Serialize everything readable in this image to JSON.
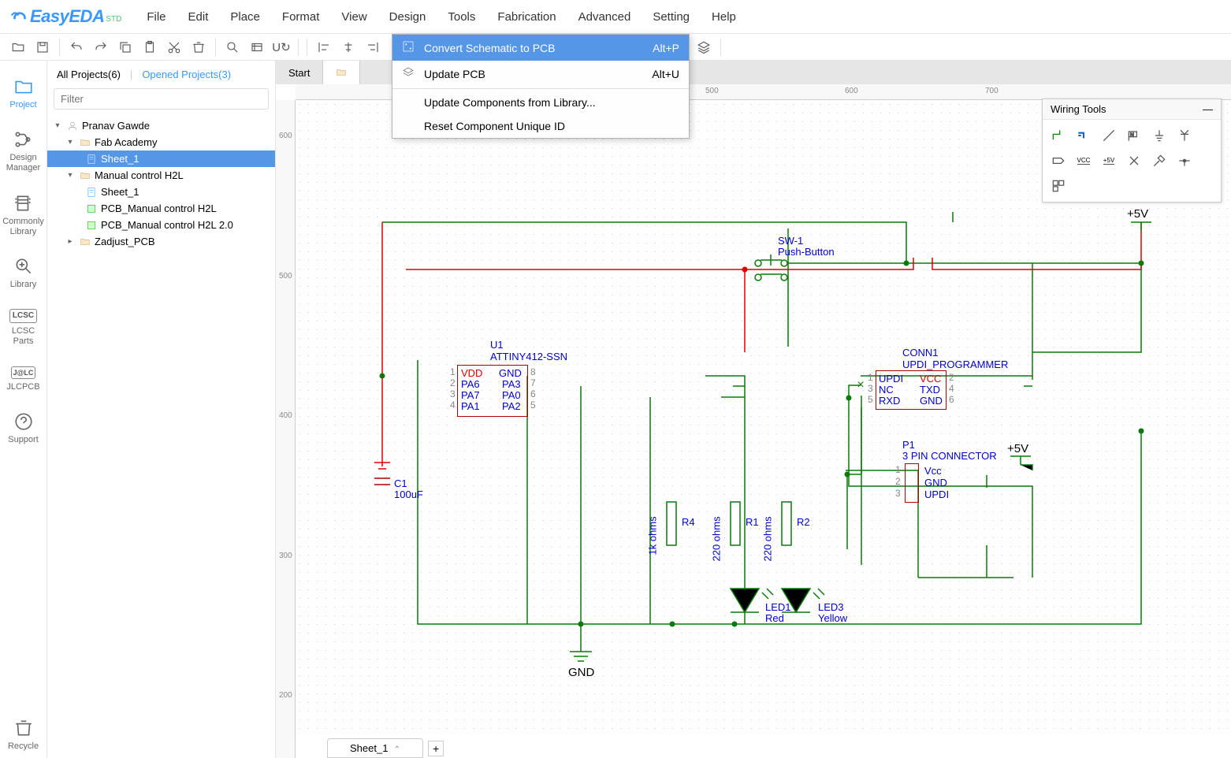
{
  "app": {
    "name": "EasyEDA",
    "edition": "STD"
  },
  "menubar": [
    "File",
    "Edit",
    "Place",
    "Format",
    "View",
    "Design",
    "Tools",
    "Fabrication",
    "Advanced",
    "Setting",
    "Help"
  ],
  "dropdown": {
    "items": [
      {
        "label": "Convert Schematic to PCB",
        "shortcut": "Alt+P",
        "highlighted": true
      },
      {
        "label": "Update PCB",
        "shortcut": "Alt+U"
      },
      {
        "sep": true
      },
      {
        "label": "Update Components from Library..."
      },
      {
        "label": "Reset Component Unique ID"
      }
    ]
  },
  "sidebar": [
    "Project",
    "Design\nManager",
    "Commonly\nLibrary",
    "Library",
    "LCSC\nParts",
    "JLCPCB",
    "Support",
    "Recycle"
  ],
  "proj_tabs": {
    "all": "All Projects(6)",
    "opened": "Opened Projects(3)"
  },
  "filter_placeholder": "Filter",
  "tree": {
    "owner": "Pranav Gawde",
    "p1": {
      "name": "Fab Academy",
      "children": [
        "Sheet_1"
      ]
    },
    "p2": {
      "name": "Manual control H2L",
      "children": [
        "Sheet_1",
        "PCB_Manual control H2L",
        "PCB_Manual control H2L 2.0"
      ]
    },
    "p3": {
      "name": "Zadjust_PCB"
    }
  },
  "tabs": [
    "Start",
    ""
  ],
  "sheet_tab": "Sheet_1",
  "ruler_h": [
    "500",
    "600",
    "700"
  ],
  "ruler_v": [
    "600",
    "500",
    "400",
    "300",
    "200"
  ],
  "wiring_title": "Wiring Tools",
  "components": {
    "u1": {
      "ref": "U1",
      "name": "ATTINY412-SSN",
      "pins_left": [
        "VDD",
        "PA6",
        "PA7",
        "PA1"
      ],
      "pins_right": [
        "GND",
        "PA3",
        "PA0",
        "PA2"
      ],
      "nums_left": [
        "1",
        "2",
        "3",
        "4"
      ],
      "nums_right": [
        "8",
        "7",
        "6",
        "5"
      ]
    },
    "conn1": {
      "ref": "CONN1",
      "name": "UPDI_PROGRAMMER",
      "pins_left": [
        "UPDI",
        "NC",
        "RXD"
      ],
      "pins_right": [
        "VCC",
        "TXD",
        "GND"
      ],
      "nums_left": [
        "1",
        "3",
        "5"
      ],
      "nums_right": [
        "2",
        "4",
        "6"
      ]
    },
    "p1": {
      "ref": "P1",
      "name": "3 PIN CONNECTOR",
      "pins": [
        "Vcc",
        "GND",
        "UPDI"
      ],
      "nums": [
        "1",
        "2",
        "3"
      ]
    },
    "sw": {
      "ref": "SW-1",
      "name": "Push-Button"
    },
    "c1": {
      "ref": "C1",
      "val": "100uF"
    },
    "r4": {
      "ref": "R4",
      "val": "1k ohms"
    },
    "r1": {
      "ref": "R1",
      "val": "220 ohms"
    },
    "r2": {
      "ref": "R2",
      "val": "220 ohms"
    },
    "led1": {
      "ref": "LED1",
      "val": "Red"
    },
    "led3": {
      "ref": "LED3",
      "val": "Yellow"
    },
    "pwr1": "+5V",
    "pwr2": "+5V",
    "gnd": "GND"
  }
}
